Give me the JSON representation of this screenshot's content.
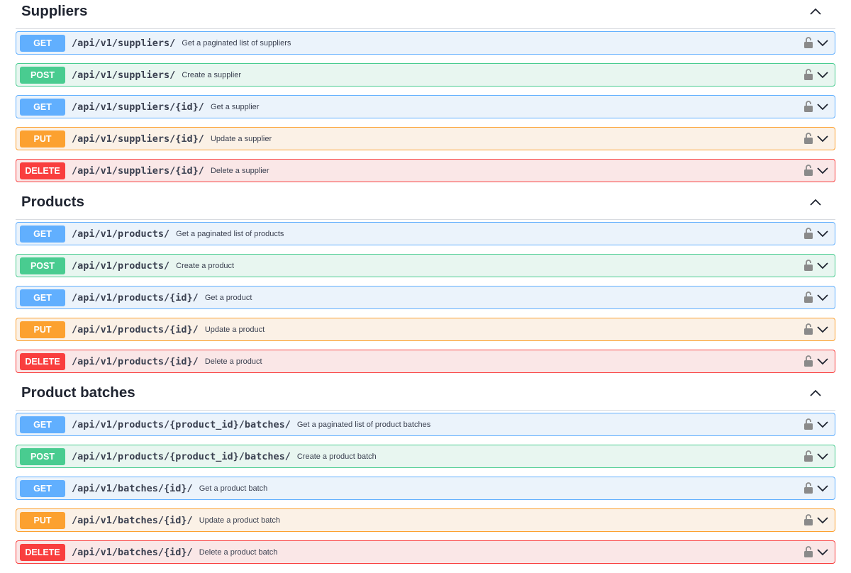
{
  "sections": [
    {
      "title": "Suppliers",
      "operations": [
        {
          "method": "GET",
          "path": "/api/v1/suppliers/",
          "summary": "Get a paginated list of suppliers"
        },
        {
          "method": "POST",
          "path": "/api/v1/suppliers/",
          "summary": "Create a supplier"
        },
        {
          "method": "GET",
          "path": "/api/v1/suppliers/{id}/",
          "summary": "Get a supplier"
        },
        {
          "method": "PUT",
          "path": "/api/v1/suppliers/{id}/",
          "summary": "Update a supplier"
        },
        {
          "method": "DELETE",
          "path": "/api/v1/suppliers/{id}/",
          "summary": "Delete a supplier"
        }
      ]
    },
    {
      "title": "Products",
      "operations": [
        {
          "method": "GET",
          "path": "/api/v1/products/",
          "summary": "Get a paginated list of products"
        },
        {
          "method": "POST",
          "path": "/api/v1/products/",
          "summary": "Create a product"
        },
        {
          "method": "GET",
          "path": "/api/v1/products/{id}/",
          "summary": "Get a product"
        },
        {
          "method": "PUT",
          "path": "/api/v1/products/{id}/",
          "summary": "Update a product"
        },
        {
          "method": "DELETE",
          "path": "/api/v1/products/{id}/",
          "summary": "Delete a product"
        }
      ]
    },
    {
      "title": "Product batches",
      "operations": [
        {
          "method": "GET",
          "path": "/api/v1/products/{product_id}/batches/",
          "summary": "Get a paginated list of product batches"
        },
        {
          "method": "POST",
          "path": "/api/v1/products/{product_id}/batches/",
          "summary": "Create a product batch"
        },
        {
          "method": "GET",
          "path": "/api/v1/batches/{id}/",
          "summary": "Get a product batch"
        },
        {
          "method": "PUT",
          "path": "/api/v1/batches/{id}/",
          "summary": "Update a product batch"
        },
        {
          "method": "DELETE",
          "path": "/api/v1/batches/{id}/",
          "summary": "Delete a product batch"
        }
      ]
    }
  ],
  "icons": {
    "section_toggle": "chevron-up-icon",
    "auth": "lock-icon",
    "expand": "chevron-down-icon"
  },
  "colors": {
    "get": "#61affe",
    "post": "#49cc90",
    "put": "#fca130",
    "delete": "#f93e3e"
  }
}
